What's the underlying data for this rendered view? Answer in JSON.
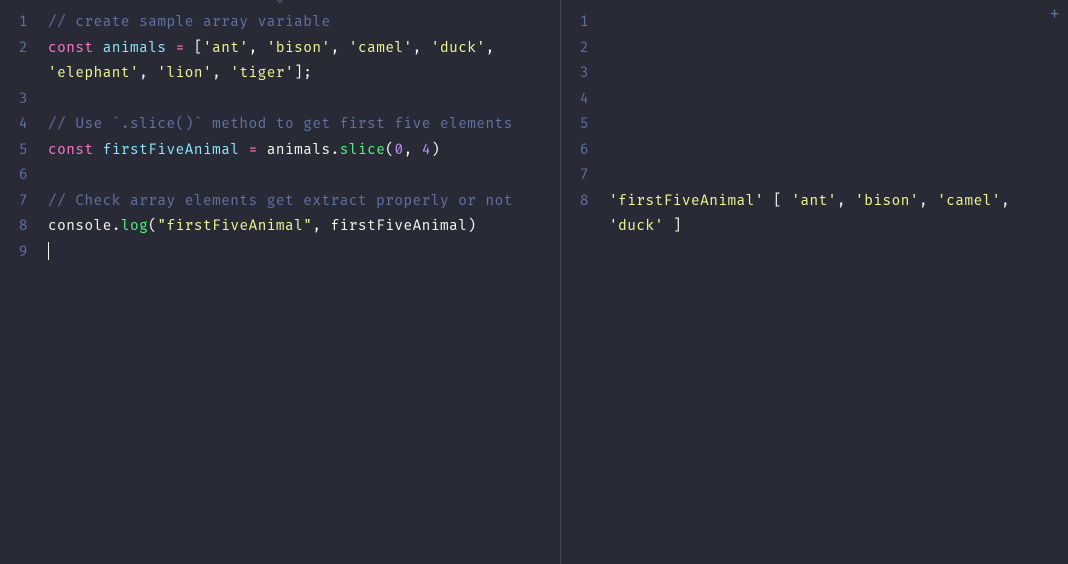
{
  "left": {
    "lineNumbers": [
      "1",
      "2",
      "",
      "3",
      "4",
      "5",
      "6",
      "7",
      "8",
      "9"
    ],
    "tokens": [
      [
        {
          "t": "// create sample array variable",
          "c": "tok-comment"
        }
      ],
      [
        {
          "t": "const ",
          "c": "tok-keyword"
        },
        {
          "t": "animals",
          "c": "tok-var"
        },
        {
          "t": " ",
          "c": ""
        },
        {
          "t": "=",
          "c": "tok-op"
        },
        {
          "t": " [",
          "c": "tok-punc"
        },
        {
          "t": "'ant'",
          "c": "tok-string"
        },
        {
          "t": ", ",
          "c": "tok-punc"
        },
        {
          "t": "'bison'",
          "c": "tok-string"
        },
        {
          "t": ", ",
          "c": "tok-punc"
        },
        {
          "t": "'camel'",
          "c": "tok-string"
        },
        {
          "t": ", ",
          "c": "tok-punc"
        },
        {
          "t": "'duck'",
          "c": "tok-string"
        },
        {
          "t": ",",
          "c": "tok-punc"
        }
      ],
      [
        {
          "t": "'elephant'",
          "c": "tok-string"
        },
        {
          "t": ", ",
          "c": "tok-punc"
        },
        {
          "t": "'lion'",
          "c": "tok-string"
        },
        {
          "t": ", ",
          "c": "tok-punc"
        },
        {
          "t": "'tiger'",
          "c": "tok-string"
        },
        {
          "t": "];",
          "c": "tok-punc"
        }
      ],
      [],
      [
        {
          "t": "// Use `.slice()` method to get first five elements",
          "c": "tok-comment"
        }
      ],
      [
        {
          "t": "const ",
          "c": "tok-keyword"
        },
        {
          "t": "firstFiveAnimal",
          "c": "tok-var"
        },
        {
          "t": " ",
          "c": ""
        },
        {
          "t": "=",
          "c": "tok-op"
        },
        {
          "t": " ",
          "c": ""
        },
        {
          "t": "animals",
          "c": "tok-var2"
        },
        {
          "t": ".",
          "c": "tok-punc"
        },
        {
          "t": "slice",
          "c": "tok-method"
        },
        {
          "t": "(",
          "c": "tok-punc"
        },
        {
          "t": "0",
          "c": "tok-number"
        },
        {
          "t": ", ",
          "c": "tok-punc"
        },
        {
          "t": "4",
          "c": "tok-number"
        },
        {
          "t": ")",
          "c": "tok-punc"
        }
      ],
      [],
      [
        {
          "t": "// Check array elements get extract properly or not",
          "c": "tok-comment"
        }
      ],
      [
        {
          "t": "console",
          "c": "tok-prop"
        },
        {
          "t": ".",
          "c": "tok-punc"
        },
        {
          "t": "log",
          "c": "tok-method"
        },
        {
          "t": "(",
          "c": "tok-punc"
        },
        {
          "t": "\"firstFiveAnimal\"",
          "c": "tok-string"
        },
        {
          "t": ", ",
          "c": "tok-punc"
        },
        {
          "t": "firstFiveAnimal",
          "c": "tok-var2"
        },
        {
          "t": ")",
          "c": "tok-punc"
        }
      ],
      [
        {
          "t": "",
          "c": "",
          "cursor": true
        }
      ]
    ]
  },
  "right": {
    "lineNumbers": [
      "1",
      "2",
      "3",
      "4",
      "5",
      "6",
      "7",
      "8",
      ""
    ],
    "tokens": [
      [],
      [],
      [],
      [],
      [],
      [],
      [],
      [
        {
          "t": "'firstFiveAnimal'",
          "c": "tok-string"
        },
        {
          "t": " [ ",
          "c": "tok-punc"
        },
        {
          "t": "'ant'",
          "c": "tok-string"
        },
        {
          "t": ", ",
          "c": "tok-punc"
        },
        {
          "t": "'bison'",
          "c": "tok-string"
        },
        {
          "t": ", ",
          "c": "tok-punc"
        },
        {
          "t": "'camel'",
          "c": "tok-string"
        },
        {
          "t": ",",
          "c": "tok-punc"
        }
      ],
      [
        {
          "t": "'duck'",
          "c": "tok-string"
        },
        {
          "t": " ]",
          "c": "tok-punc"
        }
      ]
    ]
  },
  "icons": {
    "add": "+",
    "topMark": "⌄"
  }
}
